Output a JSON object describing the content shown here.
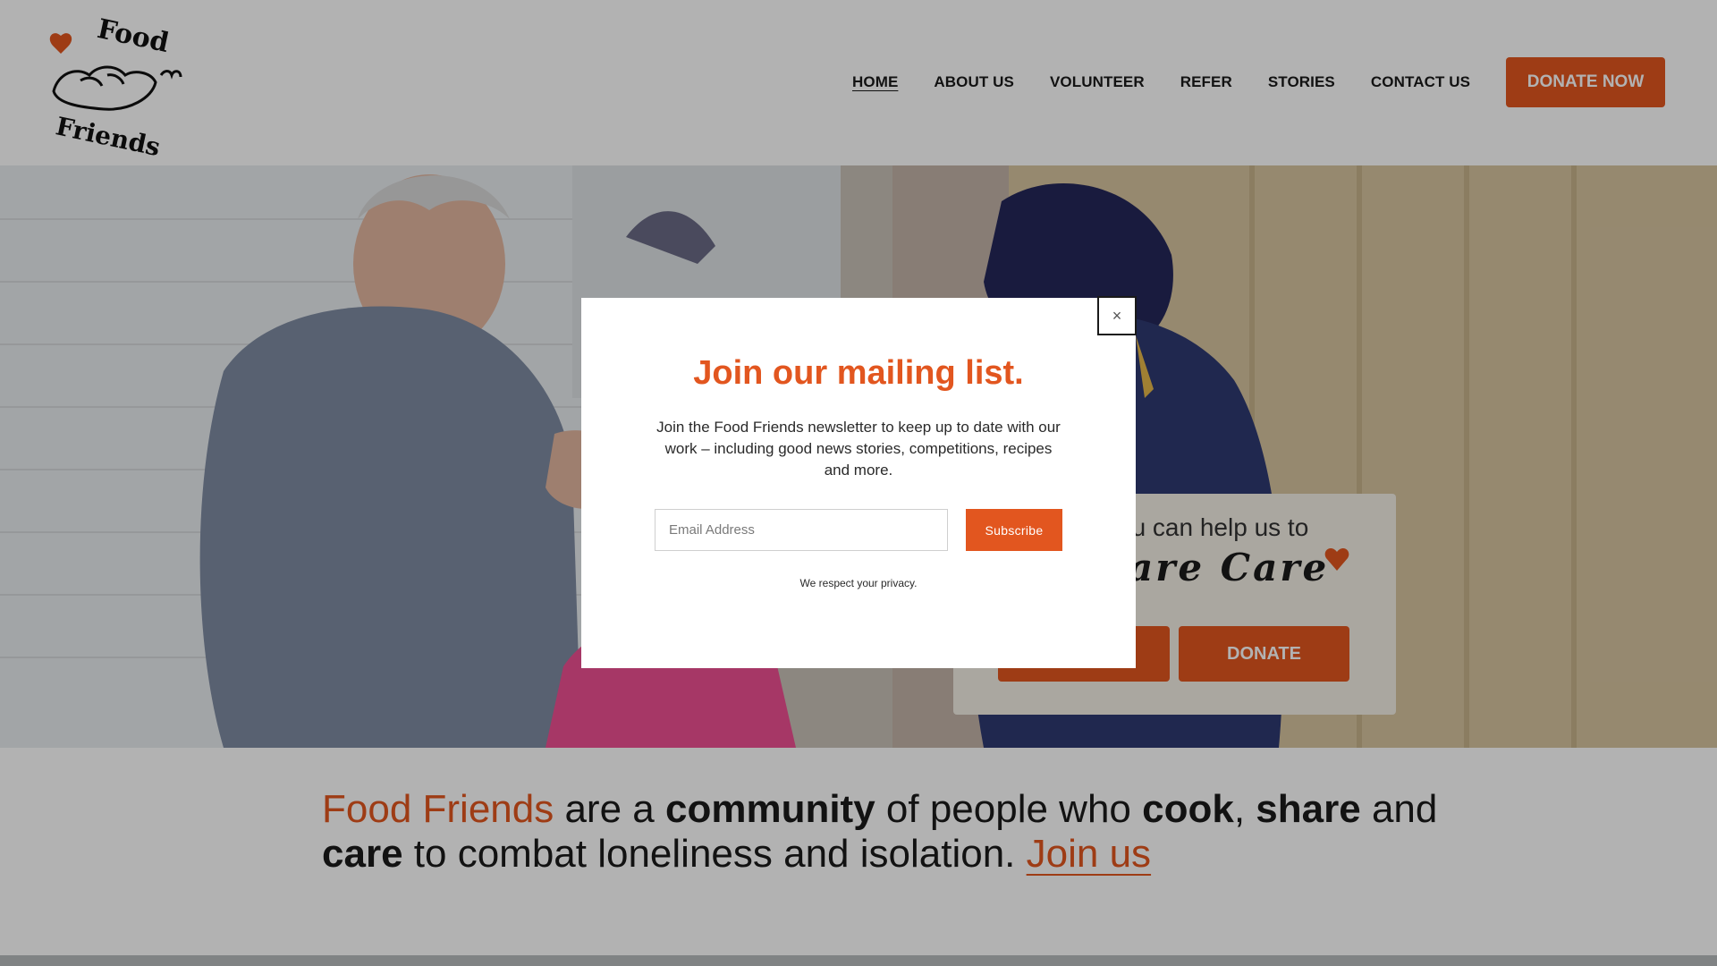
{
  "header": {
    "logo_text_top": "Food",
    "logo_text_bottom": "Friends",
    "nav": [
      {
        "label": "HOME",
        "active": true
      },
      {
        "label": "ABOUT US"
      },
      {
        "label": "VOLUNTEER"
      },
      {
        "label": "REFER"
      },
      {
        "label": "STORIES"
      },
      {
        "label": "CONTACT US"
      }
    ],
    "donate_now_label": "DONATE NOW"
  },
  "hero": {
    "cta_line1": "ou can help us to",
    "cta_line2": "are Care",
    "cta_button_1": "",
    "cta_button_2": "DONATE"
  },
  "tagline": {
    "brand": "Food Friends",
    "t1": " are a ",
    "community": "community",
    "t2": " of people who ",
    "cook": "cook",
    "t3": ", ",
    "share": "share",
    "t4": " and ",
    "care": "care",
    "t5": " to combat loneliness and isolation. ",
    "join": "Join us"
  },
  "modal": {
    "close_label": "×",
    "title": "Join our mailing list.",
    "body": "Join the Food Friends newsletter to keep up to date with our work – including good news stories, competitions, recipes and more.",
    "email_placeholder": "Email Address",
    "subscribe_label": "Subscribe",
    "privacy": "We respect your privacy."
  },
  "colors": {
    "accent": "#e2561f",
    "text": "#1a1a1a",
    "overlay": "rgba(0,0,0,0.30)"
  }
}
